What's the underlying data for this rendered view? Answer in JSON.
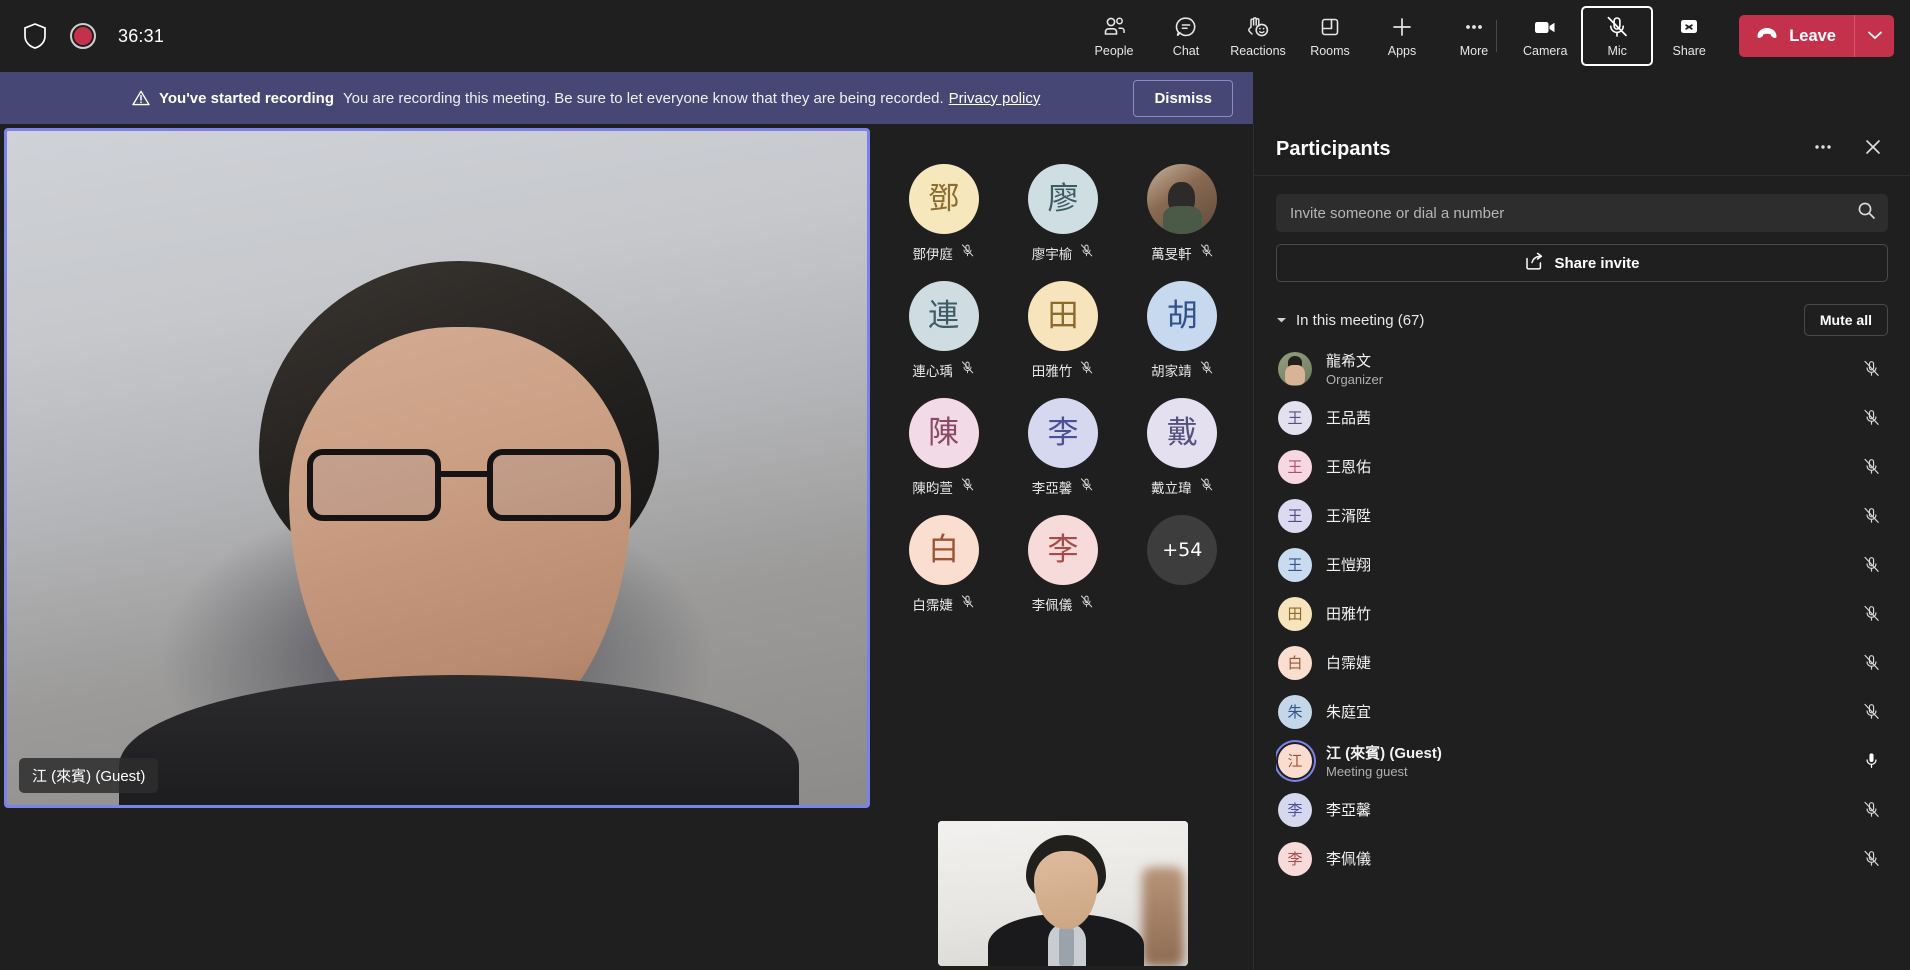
{
  "topbar": {
    "shield_icon": "shield-icon",
    "recording_icon": "recording-dot-icon",
    "timer": "36:31",
    "items": [
      {
        "label": "People",
        "icon": "people-icon"
      },
      {
        "label": "Chat",
        "icon": "chat-icon"
      },
      {
        "label": "Reactions",
        "icon": "reactions-icon"
      },
      {
        "label": "Rooms",
        "icon": "rooms-icon"
      },
      {
        "label": "Apps",
        "icon": "apps-plus-icon"
      },
      {
        "label": "More",
        "icon": "more-ellipsis-icon"
      }
    ],
    "controls": [
      {
        "label": "Camera",
        "icon": "camera-icon",
        "state": "on"
      },
      {
        "label": "Mic",
        "icon": "mic-off-icon",
        "state": "muted"
      },
      {
        "label": "Share",
        "icon": "share-stop-icon",
        "state": "off"
      }
    ],
    "leave_label": "Leave",
    "leave_caret_icon": "chevron-down-icon",
    "leave_color": "#c4314b"
  },
  "banner": {
    "warning_icon": "warning-triangle-icon",
    "title": "You've started recording",
    "message": "You are recording this meeting. Be sure to let everyone know that they are being recorded.",
    "link": "Privacy policy",
    "dismiss_label": "Dismiss",
    "background": "#464775"
  },
  "stage": {
    "main_video": {
      "name_label": "江 (來賓) (Guest)",
      "speaking_border": "#7b83eb"
    },
    "second_video": {
      "name_label": ""
    },
    "avatar_grid": [
      {
        "initial": "鄧",
        "name": "鄧伊庭",
        "bg": "#f7e7bd",
        "fg": "#8a6d2f",
        "muted": true,
        "photo": false
      },
      {
        "initial": "廖",
        "name": "廖宇榆",
        "bg": "#cfdee2",
        "fg": "#3d5b63",
        "muted": true,
        "photo": false
      },
      {
        "initial": "萬",
        "name": "萬旻軒",
        "bg": "#8a6a52",
        "fg": "#ffffff",
        "muted": true,
        "photo": true
      },
      {
        "initial": "連",
        "name": "連心瑀",
        "bg": "#cfdce2",
        "fg": "#3e5b66",
        "muted": true,
        "photo": false
      },
      {
        "initial": "田",
        "name": "田雅竹",
        "bg": "#f7e4bd",
        "fg": "#8a6b2c",
        "muted": true,
        "photo": false
      },
      {
        "initial": "胡",
        "name": "胡家靖",
        "bg": "#c7d9ef",
        "fg": "#33518a",
        "muted": true,
        "photo": false
      },
      {
        "initial": "陳",
        "name": "陳昀萱",
        "bg": "#f2dbe6",
        "fg": "#8a4a63",
        "muted": true,
        "photo": false
      },
      {
        "initial": "李",
        "name": "李亞馨",
        "bg": "#d6d8f0",
        "fg": "#4a4f96",
        "muted": true,
        "photo": false
      },
      {
        "initial": "戴",
        "name": "戴立瑋",
        "bg": "#e5e0f0",
        "fg": "#55527d",
        "muted": true,
        "photo": false
      },
      {
        "initial": "白",
        "name": "白霈婕",
        "bg": "#fadfd0",
        "fg": "#9c5437",
        "muted": true,
        "photo": false
      },
      {
        "initial": "李",
        "name": "李佩儀",
        "bg": "#f7dada",
        "fg": "#a84a4a",
        "muted": true,
        "photo": false
      }
    ],
    "overflow_label": "+54"
  },
  "panel": {
    "title": "Participants",
    "more_icon": "more-ellipsis-icon",
    "close_icon": "close-icon",
    "search": {
      "placeholder": "Invite someone or dial a number",
      "value": "",
      "icon": "search-icon"
    },
    "share_invite_label": "Share invite",
    "share_invite_icon": "share-invite-icon",
    "section_label": "In this meeting (67)",
    "section_caret_icon": "caret-down-icon",
    "mute_all_label": "Mute all",
    "participants": [
      {
        "initial": "龍",
        "name": "龍希文",
        "sub": "Organizer",
        "bg": "#93a07f",
        "fg": "#ffffff",
        "muted": true,
        "photo": true,
        "speaking": false,
        "bold": false
      },
      {
        "initial": "王",
        "name": "王品茜",
        "sub": "",
        "bg": "#e3e0f0",
        "fg": "#55527d",
        "muted": true,
        "photo": false,
        "speaking": false,
        "bold": false
      },
      {
        "initial": "王",
        "name": "王恩佑",
        "sub": "",
        "bg": "#f7d8e2",
        "fg": "#a8526e",
        "muted": true,
        "photo": false,
        "speaking": false,
        "bold": false
      },
      {
        "initial": "王",
        "name": "王湑陞",
        "sub": "",
        "bg": "#dcdaf0",
        "fg": "#4f4c85",
        "muted": true,
        "photo": false,
        "speaking": false,
        "bold": false
      },
      {
        "initial": "王",
        "name": "王愷翔",
        "sub": "",
        "bg": "#c9dbef",
        "fg": "#35558c",
        "muted": true,
        "photo": false,
        "speaking": false,
        "bold": false
      },
      {
        "initial": "田",
        "name": "田雅竹",
        "sub": "",
        "bg": "#f7e4bd",
        "fg": "#8a6b2c",
        "muted": true,
        "photo": false,
        "speaking": false,
        "bold": false
      },
      {
        "initial": "白",
        "name": "白霈婕",
        "sub": "",
        "bg": "#fadfd0",
        "fg": "#9c5437",
        "muted": true,
        "photo": false,
        "speaking": false,
        "bold": false
      },
      {
        "initial": "朱",
        "name": "朱庭宜",
        "sub": "",
        "bg": "#c4d7ea",
        "fg": "#34557f",
        "muted": true,
        "photo": false,
        "speaking": false,
        "bold": false
      },
      {
        "initial": "江",
        "name": "江 (來賓) (Guest)",
        "sub": "Meeting guest",
        "bg": "#fadcd0",
        "fg": "#9c5437",
        "muted": false,
        "photo": false,
        "speaking": true,
        "bold": true
      },
      {
        "initial": "李",
        "name": "李亞馨",
        "sub": "",
        "bg": "#d6d8f0",
        "fg": "#4a4f96",
        "muted": true,
        "photo": false,
        "speaking": false,
        "bold": false
      },
      {
        "initial": "李",
        "name": "李佩儀",
        "sub": "",
        "bg": "#f7dada",
        "fg": "#a84a4a",
        "muted": true,
        "photo": false,
        "speaking": false,
        "bold": false
      }
    ]
  }
}
